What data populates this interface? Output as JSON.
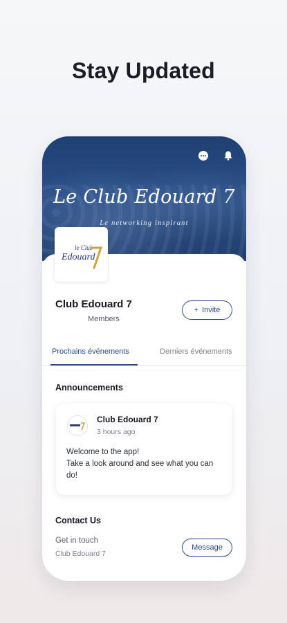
{
  "page": {
    "headline": "Stay Updated"
  },
  "hero": {
    "title": "Le Club Edouard 7",
    "subtitle": "Le networking inspirant",
    "icons": [
      "chat-bubble-icon",
      "bell-icon"
    ]
  },
  "club": {
    "logo_text_top": "le Club",
    "logo_text_main": "Edouard",
    "name": "Club Edouard 7",
    "members_label": "Members",
    "invite_label": "Invite"
  },
  "tabs": [
    {
      "label": "Prochains événements",
      "active": true
    },
    {
      "label": "Derniers événements",
      "active": false
    }
  ],
  "announcements": {
    "title": "Announcements",
    "author": "Club Edouard 7",
    "time": "3 hours ago",
    "body_line1": "Welcome to the app!",
    "body_line2": "Take a look around and see what you can do!"
  },
  "contact": {
    "title": "Contact Us",
    "line1": "Get in touch",
    "line2": "Club Edouard 7",
    "message_label": "Message"
  },
  "colors": {
    "accent": "#2c4a8a",
    "hero_bg": "#223f6e",
    "logo_gold": "#c9a24a"
  }
}
